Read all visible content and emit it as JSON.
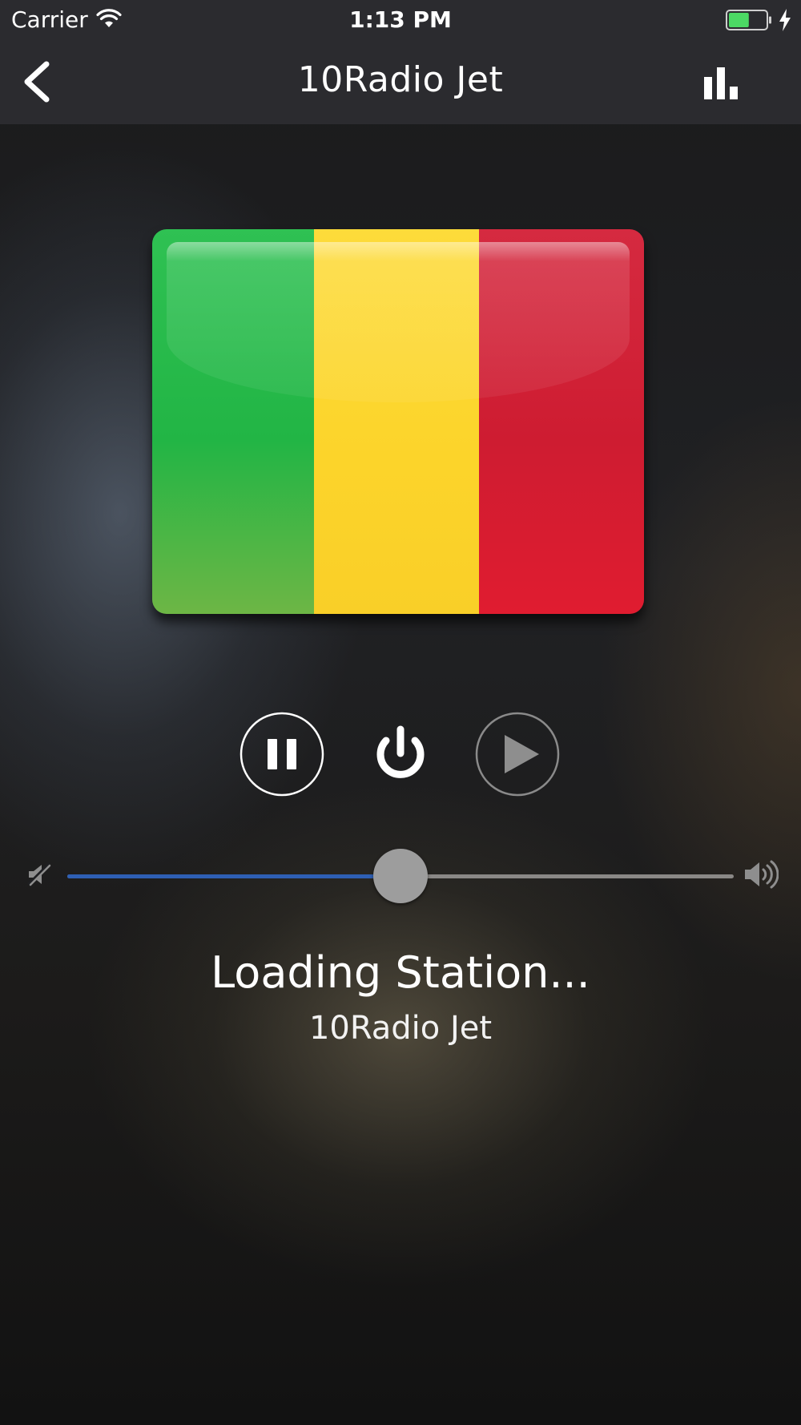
{
  "status_bar": {
    "carrier": "Carrier",
    "time": "1:13 PM",
    "battery_level": 0.55
  },
  "nav": {
    "title": "10Radio Jet",
    "back_icon": "chevron-left-icon",
    "right_icon": "bar-chart-icon"
  },
  "artwork": {
    "type": "flag",
    "colors": [
      "#22b545",
      "#fcd42a",
      "#ce1c31"
    ]
  },
  "controls": {
    "pause_icon": "pause-icon",
    "power_icon": "power-icon",
    "play_icon": "play-icon"
  },
  "volume": {
    "level": 0.5,
    "fill_color": "#2e5fb4",
    "min_icon": "mute-icon",
    "max_icon": "volume-icon"
  },
  "now_playing": {
    "status": "Loading Station...",
    "station": "10Radio Jet"
  }
}
